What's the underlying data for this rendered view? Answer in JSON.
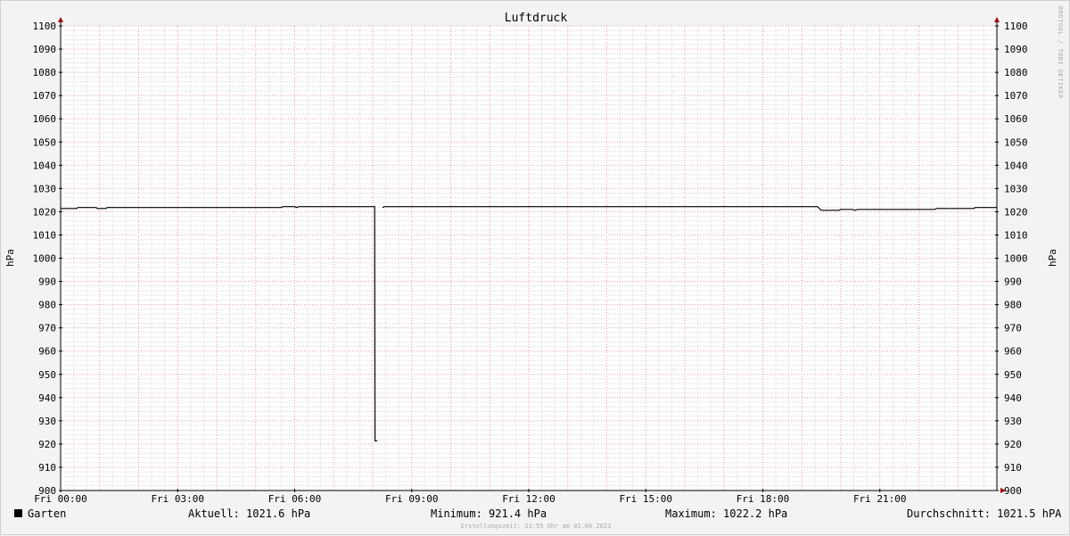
{
  "chart_data": {
    "type": "line",
    "title": "Luftdruck",
    "ylabel": "hPa",
    "ylabel_right": "hPa",
    "ylim": [
      900,
      1100
    ],
    "y_ticks": [
      900,
      910,
      920,
      930,
      940,
      950,
      960,
      970,
      980,
      990,
      1000,
      1010,
      1020,
      1030,
      1040,
      1050,
      1060,
      1070,
      1080,
      1090,
      1100
    ],
    "xlim_hours": [
      0,
      24
    ],
    "x_ticks": [
      {
        "hour": 0,
        "label": "Fri 00:00"
      },
      {
        "hour": 3,
        "label": "Fri 03:00"
      },
      {
        "hour": 6,
        "label": "Fri 06:00"
      },
      {
        "hour": 9,
        "label": "Fri 09:00"
      },
      {
        "hour": 12,
        "label": "Fri 12:00"
      },
      {
        "hour": 15,
        "label": "Fri 15:00"
      },
      {
        "hour": 18,
        "label": "Fri 18:00"
      },
      {
        "hour": 21,
        "label": "Fri 21:00"
      }
    ],
    "grid": true,
    "series": [
      {
        "name": "Garten",
        "color": "#000000",
        "segments": [
          [
            [
              0,
              1021.4
            ],
            [
              0.4,
              1021.4
            ],
            [
              0.45,
              1021.8
            ],
            [
              0.9,
              1021.8
            ],
            [
              0.95,
              1021.4
            ],
            [
              1.15,
              1021.4
            ],
            [
              1.2,
              1021.8
            ],
            [
              5.65,
              1021.8
            ],
            [
              5.7,
              1022.2
            ],
            [
              6.0,
              1022.2
            ],
            [
              6.05,
              1021.8
            ],
            [
              6.1,
              1022.2
            ],
            [
              8.05,
              1022.2
            ],
            [
              8.06,
              921.4
            ],
            [
              8.12,
              921.4
            ]
          ],
          [
            [
              8.25,
              1021.8
            ],
            [
              8.3,
              1022.2
            ],
            [
              19.4,
              1022.2
            ],
            [
              19.5,
              1020.6
            ],
            [
              19.95,
              1020.6
            ],
            [
              20.0,
              1021.0
            ],
            [
              20.3,
              1021.0
            ],
            [
              20.35,
              1020.6
            ],
            [
              20.45,
              1021.0
            ],
            [
              22.4,
              1021.0
            ],
            [
              22.45,
              1021.4
            ],
            [
              23.4,
              1021.4
            ],
            [
              23.45,
              1021.8
            ],
            [
              24.0,
              1021.8
            ]
          ]
        ]
      }
    ]
  },
  "footer": {
    "legend_label": "Garten",
    "current": "Aktuell: 1021.6 hPa",
    "minimum": "Minimum: 921.4 hPa",
    "maximum": "Maximum: 1022.2 hPa",
    "average": "Durchschnitt: 1021.5 hPA"
  },
  "credit": "Erstellungszeit: 23:55 Uhr am 02.06.2023",
  "watermark": "RRDTOOL / TOBI OETIKER",
  "colors": {
    "background": "#f3f3f3",
    "plot_area": "#ffffff",
    "minor_grid": "#dcdcdc",
    "major_grid": "#e8a0a0",
    "axis": "#000000",
    "arrow": "#a00000",
    "line": "#000000"
  }
}
